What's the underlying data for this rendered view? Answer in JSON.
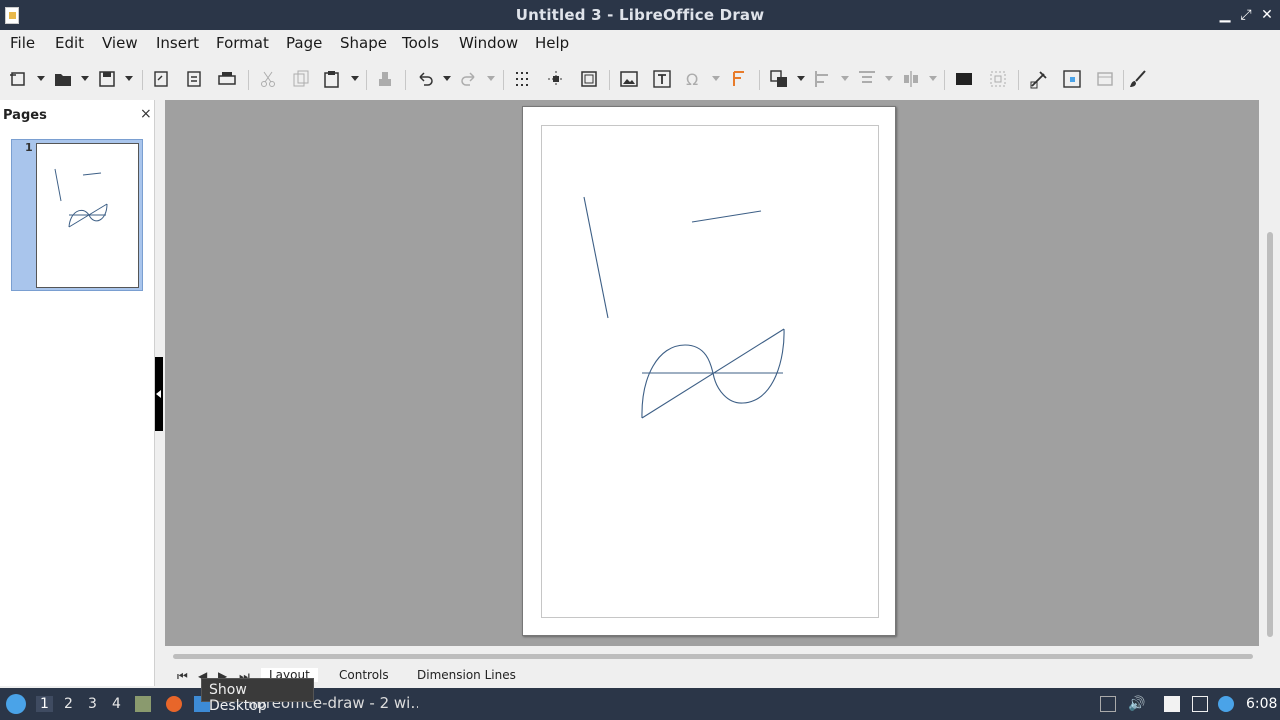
{
  "window": {
    "title": "Untitled 3 - LibreOffice Draw",
    "controls": [
      "minimize",
      "maximize",
      "close"
    ]
  },
  "menu": [
    "File",
    "Edit",
    "View",
    "Insert",
    "Format",
    "Page",
    "Shape",
    "Tools",
    "Window",
    "Help"
  ],
  "toolbar": {
    "icons": [
      "new-icon",
      "open-icon",
      "save-icon",
      "export-icon",
      "export-pdf-icon",
      "print-icon",
      "cut-icon",
      "copy-icon",
      "paste-icon",
      "clone-formatting-icon",
      "undo-icon",
      "redo-icon",
      "grid-icon",
      "helplines-icon",
      "zoom-page-icon",
      "insert-image-icon",
      "insert-textbox-icon",
      "special-character-icon",
      "fontwork-icon",
      "transformations-icon",
      "align-icon",
      "arrange-icon",
      "distribute-icon",
      "shadow-icon",
      "crop-icon",
      "toggle-extrusion-icon",
      "points-icon",
      "glue-points-icon",
      "brush-icon"
    ]
  },
  "pages_pane": {
    "header": "Pages",
    "close": "×",
    "pages": [
      {
        "number": "1"
      }
    ]
  },
  "layer_tabs": {
    "tabs": [
      "Layout",
      "Controls",
      "Dimension Lines"
    ],
    "active": "Layout"
  },
  "tooltip": "Show Desktop",
  "taskbar": {
    "workspaces": [
      "1",
      "2",
      "3",
      "4"
    ],
    "current_workspace": "1",
    "task_label": "libreoffice-draw - 2 wi…",
    "clock": "6:08"
  }
}
